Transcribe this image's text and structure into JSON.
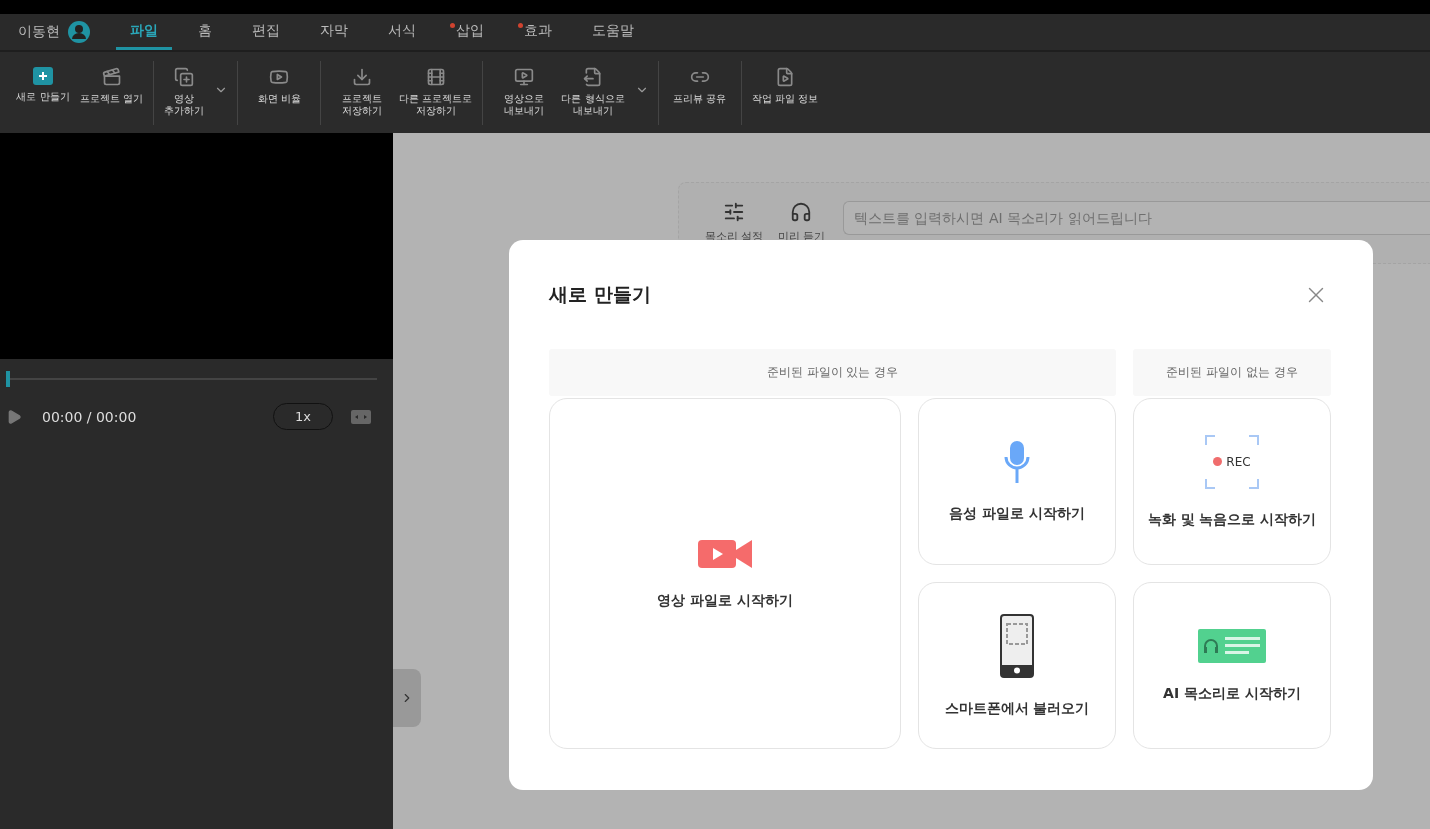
{
  "user": {
    "name": "이동현"
  },
  "tabs": [
    {
      "label": "파일",
      "selected": true,
      "badge": false
    },
    {
      "label": "홈",
      "selected": false,
      "badge": false
    },
    {
      "label": "편집",
      "selected": false,
      "badge": false
    },
    {
      "label": "자막",
      "selected": false,
      "badge": false
    },
    {
      "label": "서식",
      "selected": false,
      "badge": false
    },
    {
      "label": "삽입",
      "selected": false,
      "badge": true
    },
    {
      "label": "효과",
      "selected": false,
      "badge": true
    },
    {
      "label": "도움말",
      "selected": false,
      "badge": false
    }
  ],
  "toolbar": [
    [
      {
        "label": "새로 만들기",
        "accent": true,
        "dropdown": false
      },
      {
        "label": "프로젝트 열기",
        "accent": false,
        "dropdown": false
      }
    ],
    [
      {
        "label": "영상\n추가하기",
        "accent": false,
        "dropdown": true
      }
    ],
    [
      {
        "label": "화면 비율",
        "accent": false,
        "dropdown": false
      }
    ],
    [
      {
        "label": "프로젝트\n저장하기",
        "accent": false,
        "dropdown": false
      },
      {
        "label": "다른 프로젝트로\n저장하기",
        "accent": false,
        "dropdown": false
      }
    ],
    [
      {
        "label": "영상으로\n내보내기",
        "accent": false,
        "dropdown": false
      },
      {
        "label": "다른 형식으로\n내보내기",
        "accent": false,
        "dropdown": true
      }
    ],
    [
      {
        "label": "프리뷰 공유",
        "accent": false,
        "dropdown": false
      }
    ],
    [
      {
        "label": "작업 파일 정보",
        "accent": false,
        "dropdown": false
      }
    ]
  ],
  "player": {
    "time": "00:00 / 00:00",
    "speed": "1x",
    "level": 0
  },
  "voice_bar": {
    "buttons": [
      "목소리 설정",
      "미리 듣기"
    ],
    "placeholder": "텍스트를 입력하시면 AI 목소리가 읽어드립니다"
  },
  "dialog": {
    "title": "새로 만들기",
    "sections": [
      "준비된 파일이 있는 경우",
      "준비된 파일이 없는 경우"
    ],
    "options": [
      {
        "kind": "video",
        "label": "영상 파일로 시작하기"
      },
      {
        "kind": "audio",
        "label": "음성 파일로 시작하기"
      },
      {
        "kind": "record",
        "label": "녹화 및 녹음으로 시작하기",
        "badge": "REC"
      },
      {
        "kind": "phone",
        "label": "스마트폰에서 불러오기"
      },
      {
        "kind": "ai",
        "label": "AI 목소리로 시작하기"
      }
    ]
  }
}
